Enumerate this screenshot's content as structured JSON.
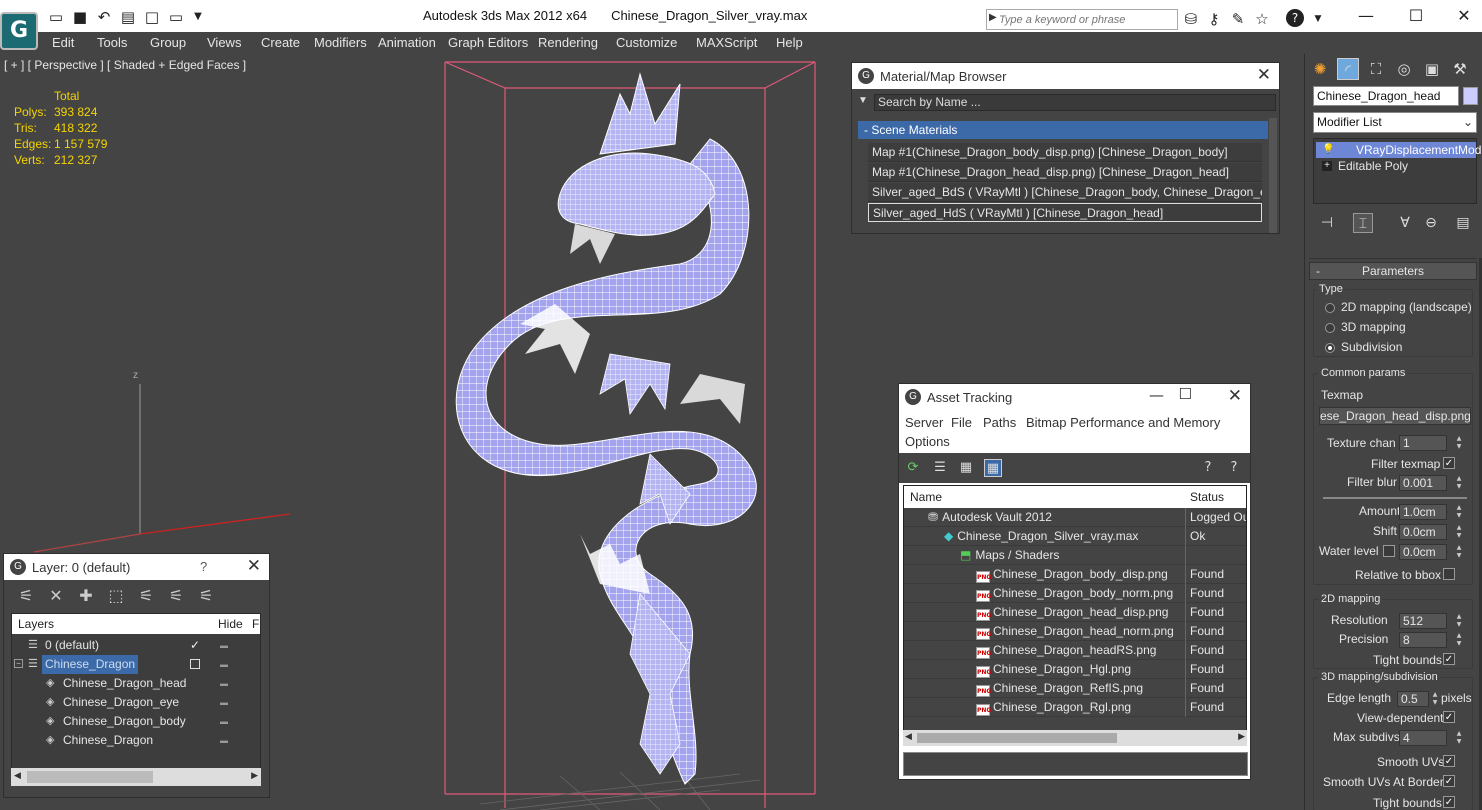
{
  "app": {
    "logo_glyph": "G",
    "title": "Autodesk 3ds Max  2012 x64",
    "filename": "Chinese_Dragon_Silver_vray.max",
    "search_placeholder": "Type a keyword or phrase"
  },
  "menu": [
    "Edit",
    "Tools",
    "Group",
    "Views",
    "Create",
    "Modifiers",
    "Animation",
    "Graph Editors",
    "Rendering",
    "Customize",
    "MAXScript",
    "Help"
  ],
  "viewport": {
    "label": "[ + ] [ Perspective ] [ Shaded + Edged Faces ]",
    "stats_header": "Total",
    "stats": [
      {
        "key": "Polys:",
        "value": "393 824"
      },
      {
        "key": "Tris:",
        "value": "418 322"
      },
      {
        "key": "Edges:",
        "value": "1 157 579"
      },
      {
        "key": "Verts:",
        "value": "212 327"
      }
    ],
    "axis_z": "z",
    "colors": {
      "stats": "#f5d400",
      "wire_fill": "#9e9ef0",
      "bbox": "#e05a78",
      "axis": "#cc2222"
    }
  },
  "material_browser": {
    "title": "Material/Map Browser",
    "search_placeholder": "Search by Name ...",
    "group": "- Scene Materials",
    "rows": [
      "Map #1(Chinese_Dragon_body_disp.png) [Chinese_Dragon_body]",
      "Map #1(Chinese_Dragon_head_disp.png) [Chinese_Dragon_head]",
      "Silver_aged_BdS  ( VRayMtl ) [Chinese_Dragon_body, Chinese_Dragon_eye]",
      "Silver_aged_HdS  ( VRayMtl ) [Chinese_Dragon_head]"
    ]
  },
  "asset_tracking": {
    "title": "Asset Tracking",
    "menu": [
      "Server",
      "File",
      "Paths",
      "Bitmap Performance and Memory",
      "Options"
    ],
    "columns": {
      "name": "Name",
      "status": "Status"
    },
    "rows": [
      {
        "name": "Autodesk Vault 2012",
        "status": "Logged Ou",
        "indent": 0,
        "icon": "vault"
      },
      {
        "name": "Chinese_Dragon_Silver_vray.max",
        "status": "Ok",
        "indent": 1,
        "icon": "max-file"
      },
      {
        "name": "Maps / Shaders",
        "status": "",
        "indent": 2,
        "icon": "maps"
      },
      {
        "name": "Chinese_Dragon_body_disp.png",
        "status": "Found",
        "indent": 3,
        "icon": "png"
      },
      {
        "name": "Chinese_Dragon_body_norm.png",
        "status": "Found",
        "indent": 3,
        "icon": "png"
      },
      {
        "name": "Chinese_Dragon_head_disp.png",
        "status": "Found",
        "indent": 3,
        "icon": "png"
      },
      {
        "name": "Chinese_Dragon_head_norm.png",
        "status": "Found",
        "indent": 3,
        "icon": "png"
      },
      {
        "name": "Chinese_Dragon_headRS.png",
        "status": "Found",
        "indent": 3,
        "icon": "png"
      },
      {
        "name": "Chinese_Dragon_Hgl.png",
        "status": "Found",
        "indent": 3,
        "icon": "png"
      },
      {
        "name": "Chinese_Dragon_RefIS.png",
        "status": "Found",
        "indent": 3,
        "icon": "png"
      },
      {
        "name": "Chinese_Dragon_Rgl.png",
        "status": "Found",
        "indent": 3,
        "icon": "png"
      }
    ],
    "png_label": "PNG"
  },
  "layers": {
    "title": "Layer: 0 (default)",
    "help": "?",
    "col_layers": "Layers",
    "col_hide": "Hide",
    "col_f": "F",
    "rows": [
      {
        "name": "0 (default)",
        "indent": 0,
        "checked": true
      },
      {
        "name": "Chinese_Dragon",
        "indent": 0,
        "selected": true
      },
      {
        "name": "Chinese_Dragon_head",
        "indent": 1
      },
      {
        "name": "Chinese_Dragon_eye",
        "indent": 1
      },
      {
        "name": "Chinese_Dragon_body",
        "indent": 1
      },
      {
        "name": "Chinese_Dragon",
        "indent": 1
      }
    ]
  },
  "command_panel": {
    "object_name": "Chinese_Dragon_head",
    "object_color": "#ccccff",
    "modifier_list": "Modifier List",
    "stack": [
      "VRayDisplacementMod",
      "Editable Poly"
    ],
    "rollout_title": "Parameters",
    "type_label": "Type",
    "type_options": [
      "2D mapping (landscape)",
      "3D mapping",
      "Subdivision"
    ],
    "type_selected": 2,
    "common_params": "Common params",
    "texmap_label": "Texmap",
    "texmap_value": "ese_Dragon_head_disp.png)",
    "texture_chan_label": "Texture chan",
    "texture_chan": "1",
    "filter_texmap": "Filter texmap",
    "filter_blur_label": "Filter blur",
    "filter_blur": "0.001",
    "amount_label": "Amount",
    "amount": "1.0cm",
    "shift_label": "Shift",
    "shift": "0.0cm",
    "water_level_label": "Water level",
    "water_level": "0.0cm",
    "relative_bbox": "Relative to bbox",
    "mapping2d": "2D mapping",
    "resolution_label": "Resolution",
    "resolution": "512",
    "precision_label": "Precision",
    "precision": "8",
    "tight_bounds": "Tight bounds",
    "mapping3d": "3D mapping/subdivision",
    "edge_length_label": "Edge length",
    "edge_length": "0.5",
    "pixels": "pixels",
    "view_dependent": "View-dependent",
    "max_subdivs_label": "Max subdivs",
    "max_subdivs": "4",
    "smooth_uvs": "Smooth UVs",
    "smooth_uvs_borders": "Smooth UVs At Borders",
    "tight_bounds2": "Tight bounds"
  }
}
